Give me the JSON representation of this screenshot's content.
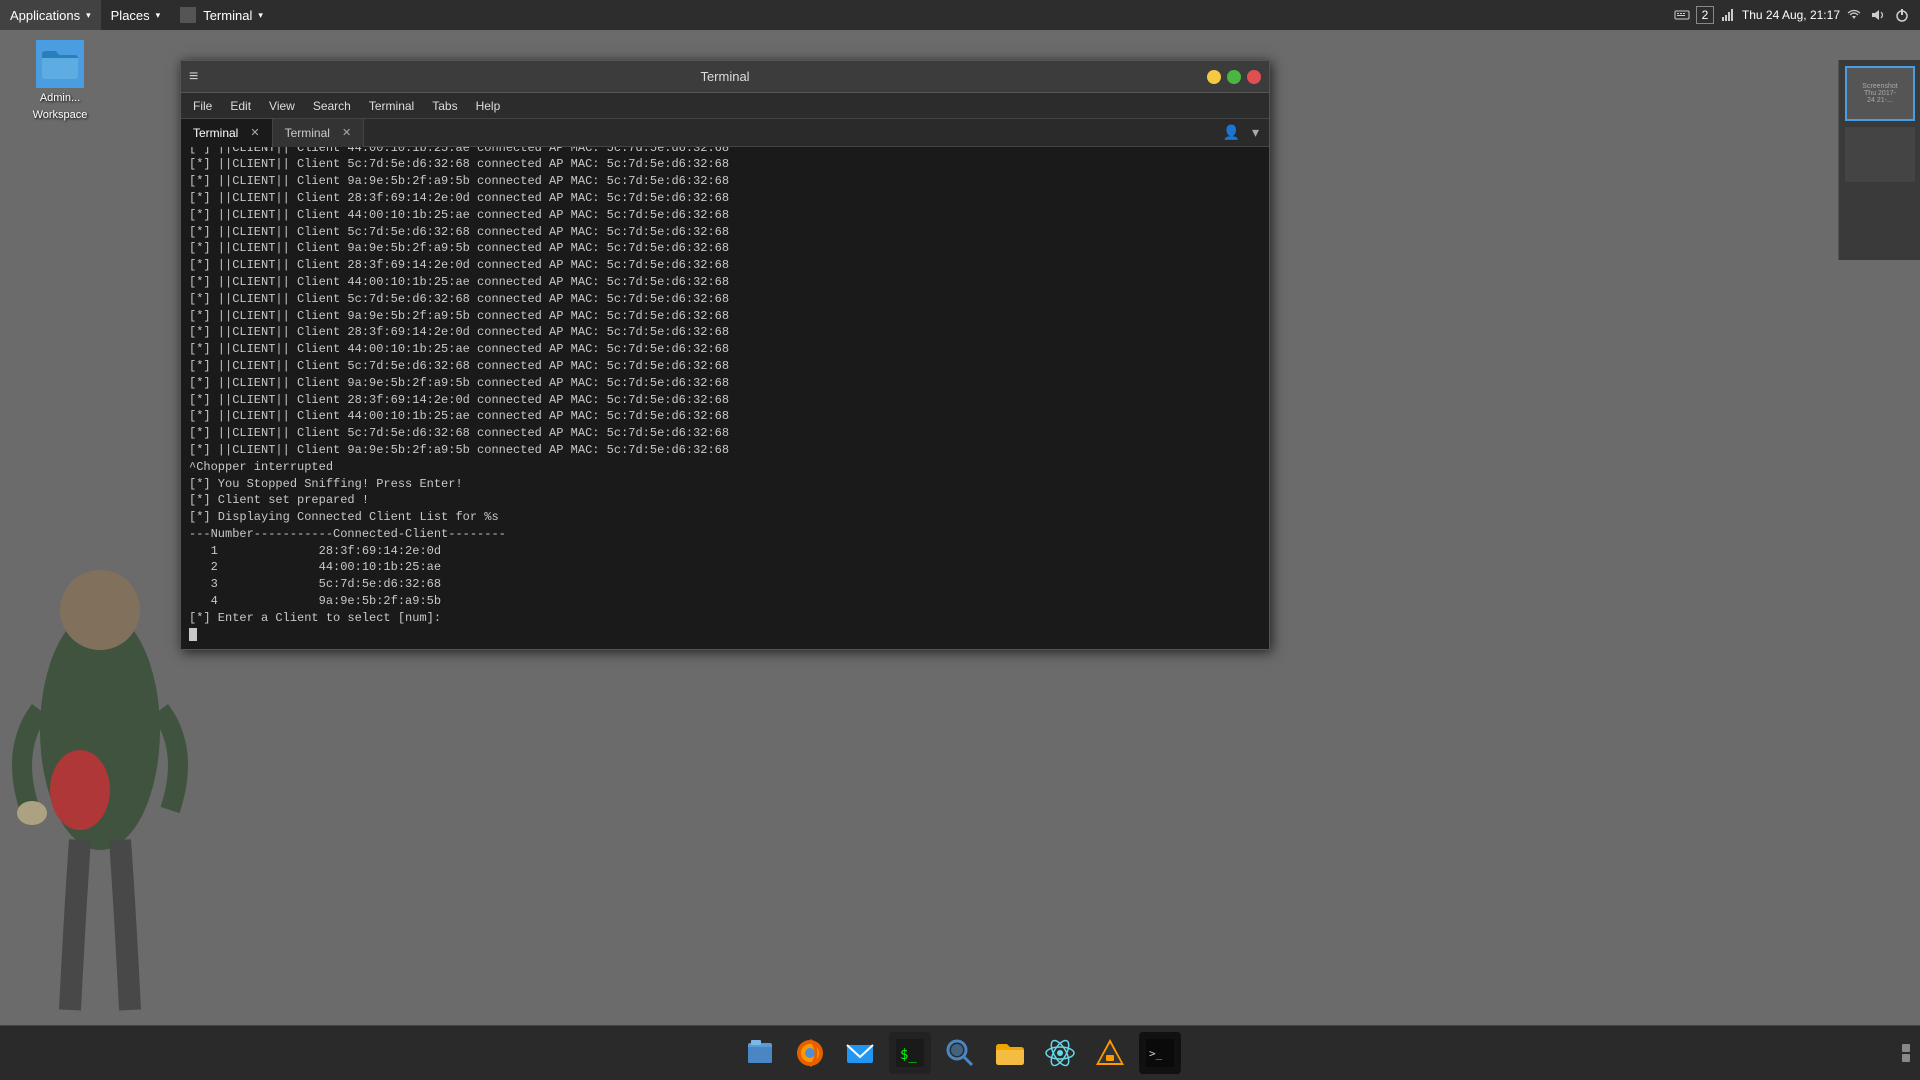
{
  "topPanel": {
    "applications": "Applications",
    "places": "Places",
    "terminal": "Terminal",
    "datetime": "Thu 24 Aug, 21:17"
  },
  "desktopIcon": {
    "label1": "Admin...",
    "label2": "Workspace"
  },
  "window": {
    "title": "Terminal",
    "menuItems": [
      "File",
      "Edit",
      "View",
      "Search",
      "Terminal",
      "Tabs",
      "Help"
    ],
    "tabs": [
      {
        "label": "Terminal",
        "active": true
      },
      {
        "label": "Terminal",
        "active": false
      }
    ]
  },
  "terminalLines": [
    "[*] ||CLIENT|| Client 44:00:10:1b:25:ae connected AP MAC: 5c:7d:5e:d6:32:68",
    "[*] ||CLIENT|| Client 5c:7d:5e:d6:32:68 connected AP MAC: 5c:7d:5e:d6:32:68",
    "[*] ||CLIENT|| Client 9a:9e:5b:2f:a9:5b connected AP MAC: 5c:7d:5e:d6:32:68",
    "[*] ||CLIENT|| Client 28:3f:69:14:2e:0d connected AP MAC: 5c:7d:5e:d6:32:68",
    "[*] ||CLIENT|| Client 44:00:10:1b:25:ae connected AP MAC: 5c:7d:5e:d6:32:68",
    "[*] ||CLIENT|| Client 5c:7d:5e:d6:32:68 connected AP MAC: 5c:7d:5e:d6:32:68",
    "[*] ||CLIENT|| Client 9a:9e:5b:2f:a9:5b connected AP MAC: 5c:7d:5e:d6:32:68",
    "[*] ||CLIENT|| Client 28:3f:69:14:2e:0d connected AP MAC: 5c:7d:5e:d6:32:68",
    "[*] ||CLIENT|| Client 44:00:10:1b:25:ae connected AP MAC: 5c:7d:5e:d6:32:68",
    "[*] ||CLIENT|| Client 5c:7d:5e:d6:32:68 connected AP MAC: 5c:7d:5e:d6:32:68",
    "[*] ||CLIENT|| Client 9a:9e:5b:2f:a9:5b connected AP MAC: 5c:7d:5e:d6:32:68",
    "[*] ||CLIENT|| Client 28:3f:69:14:2e:0d connected AP MAC: 5c:7d:5e:d6:32:68",
    "[*] ||CLIENT|| Client 44:00:10:1b:25:ae connected AP MAC: 5c:7d:5e:d6:32:68",
    "[*] ||CLIENT|| Client 5c:7d:5e:d6:32:68 connected AP MAC: 5c:7d:5e:d6:32:68",
    "[*] ||CLIENT|| Client 9a:9e:5b:2f:a9:5b connected AP MAC: 5c:7d:5e:d6:32:68",
    "[*] ||CLIENT|| Client 28:3f:69:14:2e:0d connected AP MAC: 5c:7d:5e:d6:32:68",
    "[*] ||CLIENT|| Client 44:00:10:1b:25:ae connected AP MAC: 5c:7d:5e:d6:32:68",
    "[*] ||CLIENT|| Client 5c:7d:5e:d6:32:68 connected AP MAC: 5c:7d:5e:d6:32:68",
    "[*] ||CLIENT|| Client 9a:9e:5b:2f:a9:5b connected AP MAC: 5c:7d:5e:d6:32:68",
    "[*] ||CLIENT|| Client 28:3f:69:14:2e:0d connected AP MAC: 5c:7d:5e:d6:32:68",
    "[*] ||CLIENT|| Client 44:00:10:1b:25:ae connected AP MAC: 5c:7d:5e:d6:32:68",
    "[*] ||CLIENT|| Client 5c:7d:5e:d6:32:68 connected AP MAC: 5c:7d:5e:d6:32:68",
    "[*] ||CLIENT|| Client 9a:9e:5b:2f:a9:5b connected AP MAC: 5c:7d:5e:d6:32:68",
    "[*] ||CLIENT|| Client 28:3f:69:14:2e:0d connected AP MAC: 5c:7d:5e:d6:32:68",
    "[*] ||CLIENT|| Client 44:00:10:1b:25:ae connected AP MAC: 5c:7d:5e:d6:32:68",
    "[*] ||CLIENT|| Client 5c:7d:5e:d6:32:68 connected AP MAC: 5c:7d:5e:d6:32:68",
    "[*] ||CLIENT|| Client 9a:9e:5b:2f:a9:5b connected AP MAC: 5c:7d:5e:d6:32:68",
    "[*] ||CLIENT|| Client 28:3f:69:14:2e:0d connected AP MAC: 5c:7d:5e:d6:32:68",
    "[*] ||CLIENT|| Client 44:00:10:1b:25:ae connected AP MAC: 5c:7d:5e:d6:32:68",
    "[*] ||CLIENT|| Client 5c:7d:5e:d6:32:68 connected AP MAC: 5c:7d:5e:d6:32:68",
    "[*] ||CLIENT|| Client 9a:9e:5b:2f:a9:5b connected AP MAC: 5c:7d:5e:d6:32:68",
    "^Chopper interrupted",
    "",
    "[*] You Stopped Sniffing! Press Enter!",
    "",
    "",
    "[*] Client set prepared !",
    "[*] Displaying Connected Client List for %s",
    "---Number-----------Connected-Client--------",
    "   1              28:3f:69:14:2e:0d",
    "   2              44:00:10:1b:25:ae",
    "   3              5c:7d:5e:d6:32:68",
    "   4              9a:9e:5b:2f:a9:5b",
    "[*] Enter a Client to select [num]:"
  ],
  "taskbar": {
    "icons": [
      {
        "name": "files-icon",
        "symbol": "🗂"
      },
      {
        "name": "firefox-icon",
        "symbol": "🦊"
      },
      {
        "name": "mail-icon",
        "symbol": "📫"
      },
      {
        "name": "terminal-icon",
        "symbol": "⬛"
      },
      {
        "name": "search-icon",
        "symbol": "🔍"
      },
      {
        "name": "folder-icon",
        "symbol": "📁"
      },
      {
        "name": "atom-icon",
        "symbol": "⚛"
      },
      {
        "name": "vlc-icon",
        "symbol": "🔶"
      },
      {
        "name": "console-icon",
        "symbol": "▪"
      }
    ]
  },
  "colors": {
    "minimize": "#f5c842",
    "maximize": "#4ab840",
    "close": "#e05050",
    "accent": "#4a9de0"
  }
}
